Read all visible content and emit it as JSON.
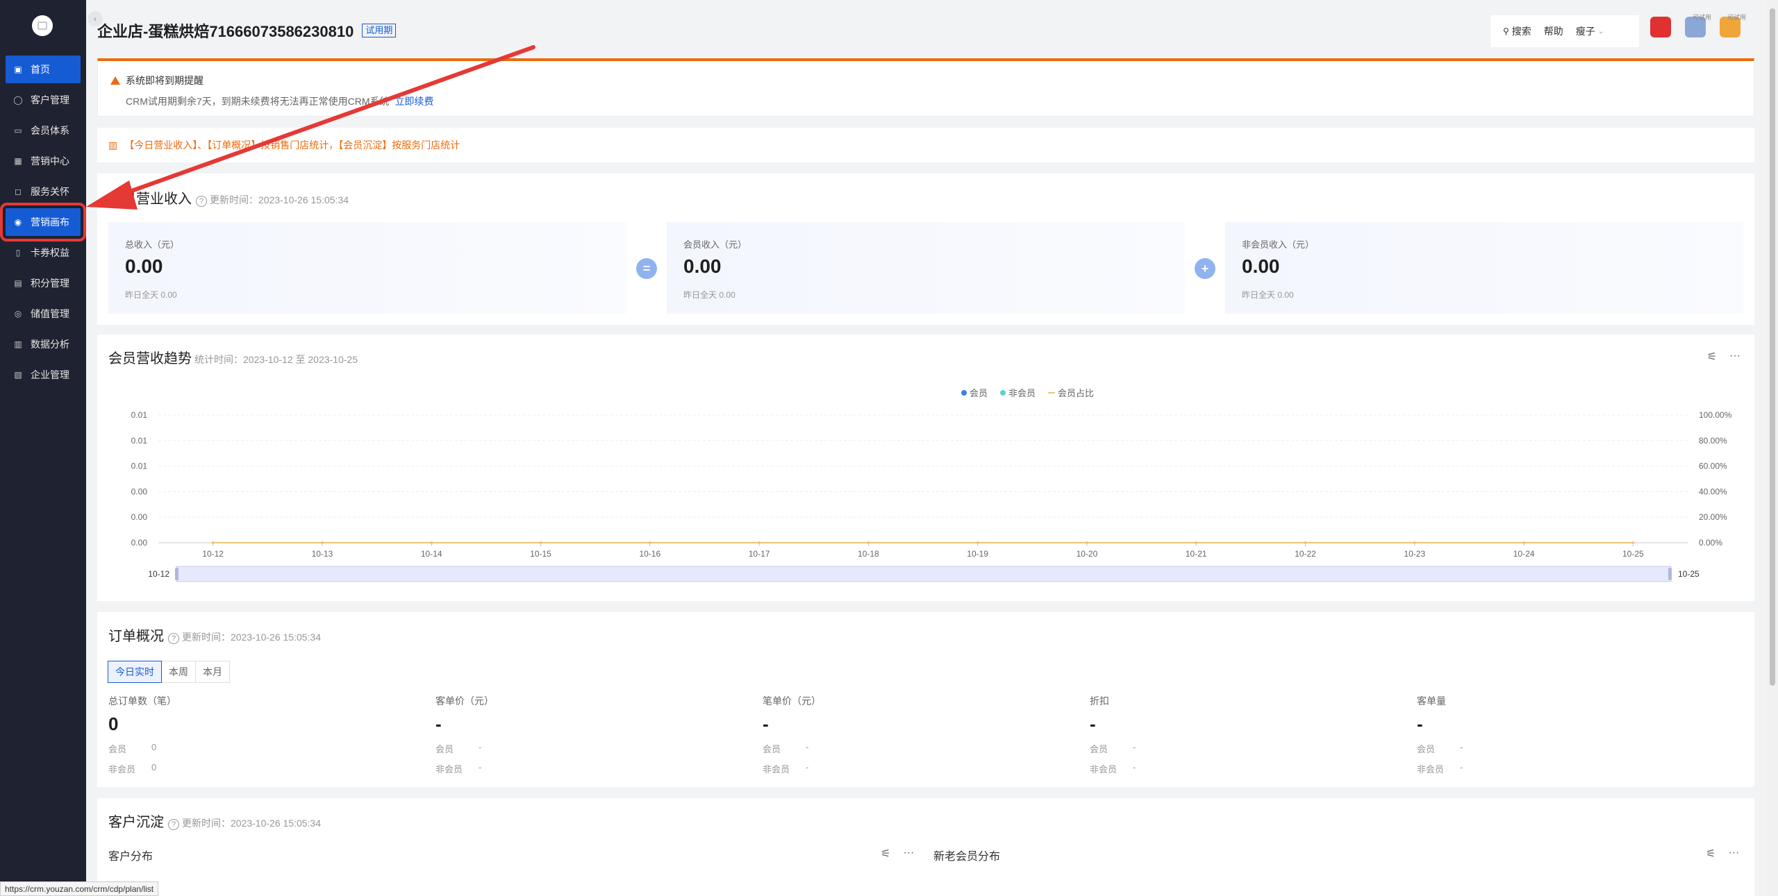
{
  "sidebar": {
    "items": [
      {
        "label": "首页",
        "icon": "home-icon",
        "glyph": "▣"
      },
      {
        "label": "客户管理",
        "icon": "user-icon",
        "glyph": "◯"
      },
      {
        "label": "会员体系",
        "icon": "card-icon",
        "glyph": "▭"
      },
      {
        "label": "营销中心",
        "icon": "gift-icon",
        "glyph": "▦"
      },
      {
        "label": "服务关怀",
        "icon": "message-icon",
        "glyph": "◻"
      },
      {
        "label": "营销画布",
        "icon": "canvas-icon",
        "glyph": "◉"
      },
      {
        "label": "卡券权益",
        "icon": "coupon-icon",
        "glyph": "▯"
      },
      {
        "label": "积分管理",
        "icon": "points-icon",
        "glyph": "▤"
      },
      {
        "label": "储值管理",
        "icon": "wallet-icon",
        "glyph": "◎"
      },
      {
        "label": "数据分析",
        "icon": "chart-icon",
        "glyph": "▥"
      },
      {
        "label": "企业管理",
        "icon": "building-icon",
        "glyph": "▧"
      }
    ]
  },
  "header": {
    "shop_title": "企业店-蛋糕烘焙71666073586230810",
    "trial_badge": "试用期",
    "search": "搜索",
    "help": "帮助",
    "user": "瘦子",
    "app_hint_1": "可试用",
    "app_hint_2": "可试用"
  },
  "warning": {
    "title": "系统即将到期提醒",
    "text": "CRM试用期剩余7天，到期未续费将无法再正常使用CRM系统",
    "link": "立即续费"
  },
  "notice": {
    "text": "【今日营业收入】、【订单概况】按销售门店统计，【会员沉淀】按服务门店统计"
  },
  "revenue": {
    "title": "今日营业收入",
    "updated": "更新时间：2023-10-26 15:05:34",
    "cards": [
      {
        "label": "总收入（元）",
        "value": "0.00",
        "sub": "昨日全天  0.00"
      },
      {
        "label": "会员收入（元）",
        "value": "0.00",
        "sub": "昨日全天  0.00"
      },
      {
        "label": "非会员收入（元）",
        "value": "0.00",
        "sub": "昨日全天  0.00"
      }
    ],
    "op_equals": "=",
    "op_plus": "+"
  },
  "trend": {
    "title": "会员营收趋势",
    "period": "统计时间：2023-10-12 至 2023-10-25",
    "zoom_start": "10-12",
    "zoom_end": "10-25"
  },
  "chart_data": {
    "type": "line",
    "x": [
      "10-12",
      "10-13",
      "10-14",
      "10-15",
      "10-16",
      "10-17",
      "10-18",
      "10-19",
      "10-20",
      "10-21",
      "10-22",
      "10-23",
      "10-24",
      "10-25"
    ],
    "series": [
      {
        "name": "会员",
        "values": [
          0,
          0,
          0,
          0,
          0,
          0,
          0,
          0,
          0,
          0,
          0,
          0,
          0,
          0
        ],
        "color": "#3a7ee8"
      },
      {
        "name": "非会员",
        "values": [
          0,
          0,
          0,
          0,
          0,
          0,
          0,
          0,
          0,
          0,
          0,
          0,
          0,
          0
        ],
        "color": "#5cd0d0"
      },
      {
        "name": "会员占比",
        "values": [
          0,
          0,
          0,
          0,
          0,
          0,
          0,
          0,
          0,
          0,
          0,
          0,
          0,
          0
        ],
        "color": "#f2c27a",
        "axis": "right"
      }
    ],
    "y_ticks_left": [
      "0.01",
      "0.01",
      "0.01",
      "0.00",
      "0.00",
      "0.00"
    ],
    "y_ticks_right": [
      "100.00%",
      "80.00%",
      "60.00%",
      "40.00%",
      "20.00%",
      "0.00%"
    ],
    "ylim_right": [
      0,
      100
    ],
    "grid": true,
    "legend": "top-center"
  },
  "orders": {
    "title": "订单概况",
    "updated": "更新时间：2023-10-26 15:05:34",
    "tabs": [
      "今日实时",
      "本周",
      "本月"
    ],
    "columns": [
      {
        "head": "总订单数（笔）",
        "value": "0",
        "member_label": "会员",
        "member": "0",
        "non_label": "非会员",
        "non": "0"
      },
      {
        "head": "客单价（元）",
        "value": "-",
        "member_label": "会员",
        "member": "-",
        "non_label": "非会员",
        "non": "-"
      },
      {
        "head": "笔单价（元）",
        "value": "-",
        "member_label": "会员",
        "member": "-",
        "non_label": "非会员",
        "non": "-"
      },
      {
        "head": "折扣",
        "value": "-",
        "member_label": "会员",
        "member": "-",
        "non_label": "非会员",
        "non": "-"
      },
      {
        "head": "客单量",
        "value": "-",
        "member_label": "会员",
        "member": "-",
        "non_label": "非会员",
        "non": "-"
      }
    ]
  },
  "customers": {
    "title": "客户沉淀",
    "updated": "更新时间：2023-10-26 15:05:34",
    "left_title": "客户分布",
    "right_title": "新老会员分布"
  },
  "status_bar": {
    "url": "https://crm.youzan.com/crm/cdp/plan/list"
  },
  "colors": {
    "sidebar_bg": "#1f2230",
    "accent": "#155bd4",
    "warning": "#ed6a0c",
    "annotation": "#e53935"
  }
}
